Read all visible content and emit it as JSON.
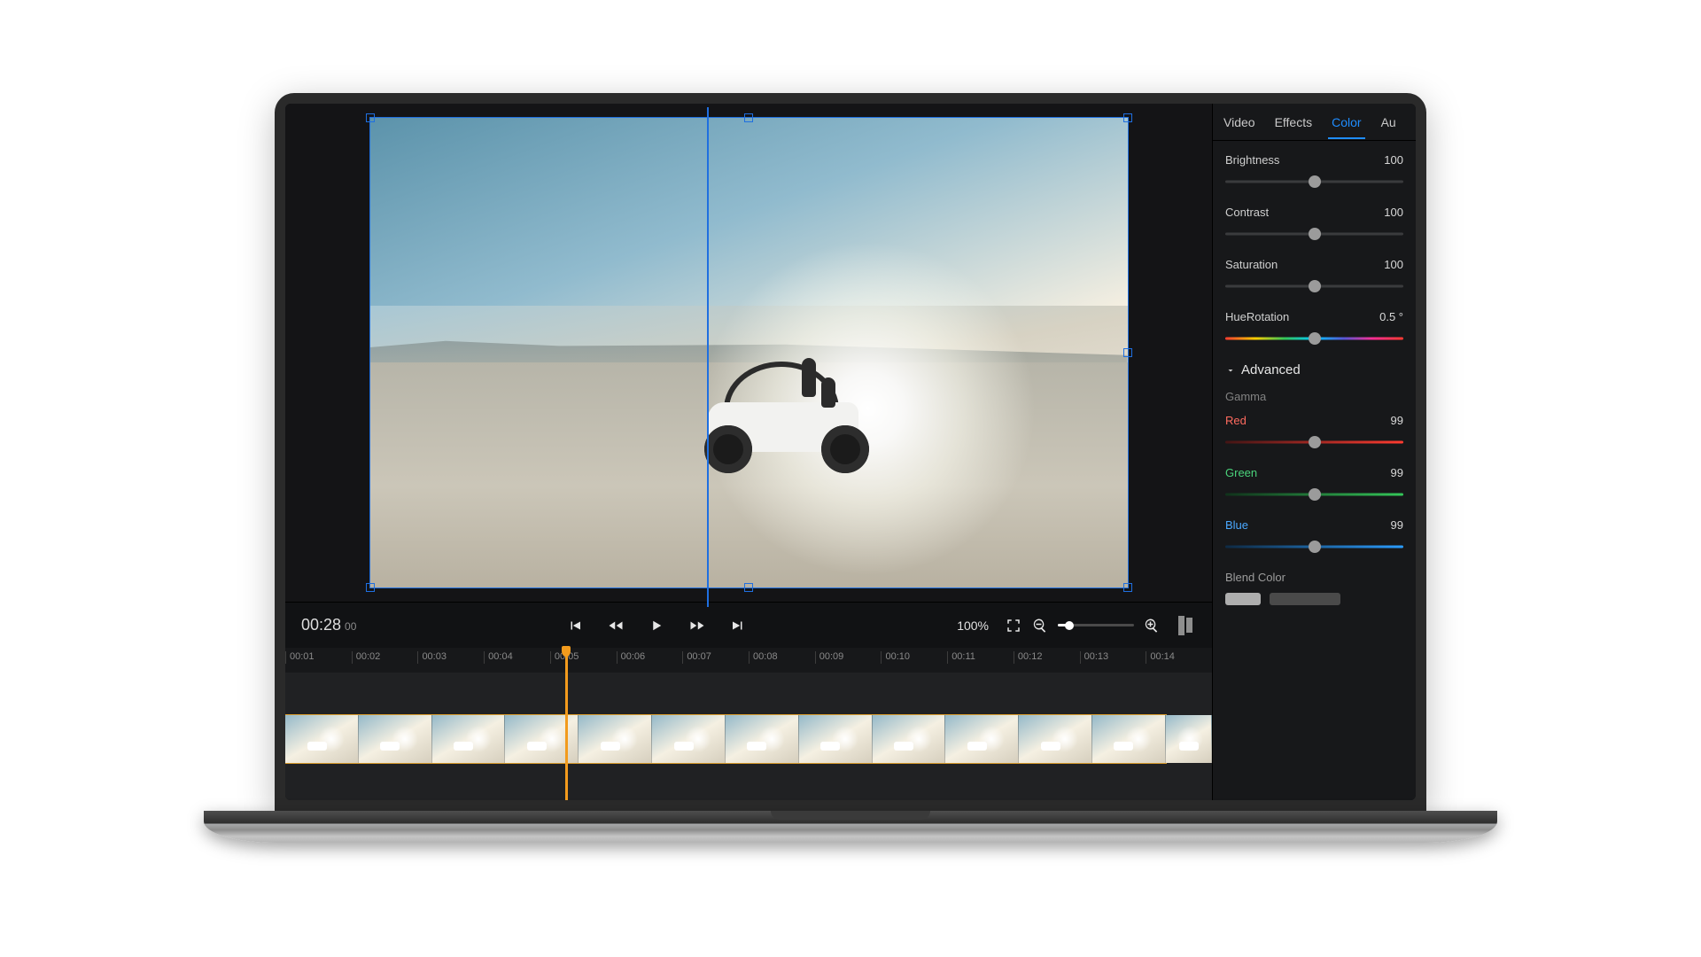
{
  "playback": {
    "time_main": "00:28",
    "time_sub": "00",
    "zoom_label": "100%"
  },
  "timeline": {
    "marks": [
      "00:01",
      "00:02",
      "00:03",
      "00:04",
      "00:05",
      "00:06",
      "00:07",
      "00:08",
      "00:09",
      "00:10",
      "00:11",
      "00:12",
      "00:13",
      "00:14"
    ],
    "playhead_mark_index": 4
  },
  "tabs": {
    "items": [
      {
        "label": "Video",
        "active": false
      },
      {
        "label": "Effects",
        "active": false
      },
      {
        "label": "Color",
        "active": true
      },
      {
        "label": "Au",
        "active": false
      }
    ]
  },
  "props": {
    "brightness": {
      "label": "Brightness",
      "value": "100",
      "pos": 50
    },
    "contrast": {
      "label": "Contrast",
      "value": "100",
      "pos": 50
    },
    "saturation": {
      "label": "Saturation",
      "value": "100",
      "pos": 50
    },
    "hue": {
      "label": "HueRotation",
      "value": "0.5 °",
      "pos": 50
    }
  },
  "advanced": {
    "title": "Advanced",
    "gamma_label": "Gamma",
    "red": {
      "label": "Red",
      "value": "99",
      "pos": 50
    },
    "green": {
      "label": "Green",
      "value": "99",
      "pos": 50
    },
    "blue": {
      "label": "Blue",
      "value": "99",
      "pos": 50
    },
    "blend_label": "Blend Color"
  }
}
